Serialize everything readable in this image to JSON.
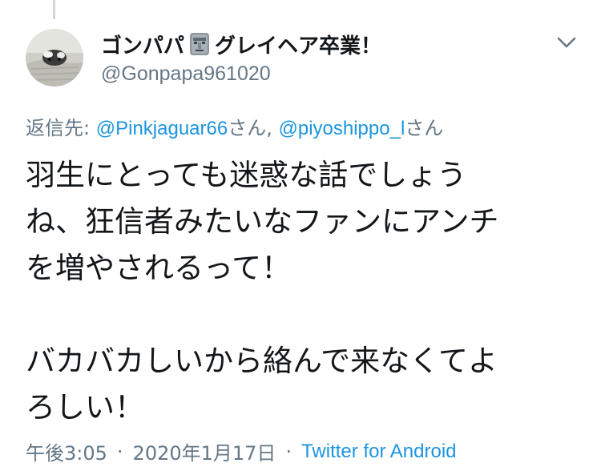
{
  "tweet": {
    "display_name_before_emoji": "ゴンパパ",
    "display_name_emoji_icon": "moai-icon",
    "display_name_after_emoji": "グレイヘア卒業！",
    "handle": "@Gonpapa961020",
    "reply_to": {
      "prefix": "返信先:",
      "mention_1": "@Pinkjaguar66",
      "san_1": "さん,",
      "mention_2": "@piyoshippo_l",
      "san_2": "さん"
    },
    "text_lines": [
      "羽生にとっても迷惑な話でしょう",
      "ね、狂信者みたいなファンにアンチ",
      "を増やされるって！",
      "",
      "バカバカしいから絡んで来なくてよ",
      "ろしい！"
    ],
    "time": "午後3:05",
    "dot": "·",
    "date": "2020年1月17日",
    "source": "Twitter for Android"
  },
  "colors": {
    "text_primary": "#14171a",
    "text_secondary": "#657786",
    "link": "#1b95e0",
    "thread_line": "#ccd6dd"
  },
  "icons": {
    "caret": "chevron-down-icon",
    "avatar": "avatar"
  }
}
